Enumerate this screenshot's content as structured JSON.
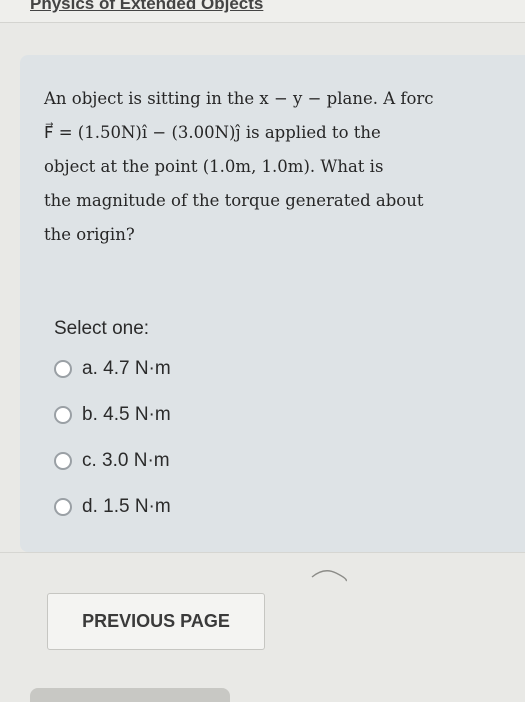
{
  "breadcrumb": {
    "text": "Physics of Extended Objects"
  },
  "question": {
    "lines": [
      "An object is sitting in the x − y − plane. A forc",
      "F⃗ = (1.50N)î − (3.00N)ĵ  is applied to the",
      "object at the point (1.0m, 1.0m). What is",
      "the magnitude of the torque generated about",
      "the origin?"
    ],
    "prompt": "Select one:",
    "options": [
      {
        "label": "a. 4.7 N·m"
      },
      {
        "label": "b. 4.5 N·m"
      },
      {
        "label": "c. 3.0 N·m"
      },
      {
        "label": "d. 1.5 N·m"
      }
    ]
  },
  "navigation": {
    "previous_label": "PREVIOUS PAGE"
  }
}
